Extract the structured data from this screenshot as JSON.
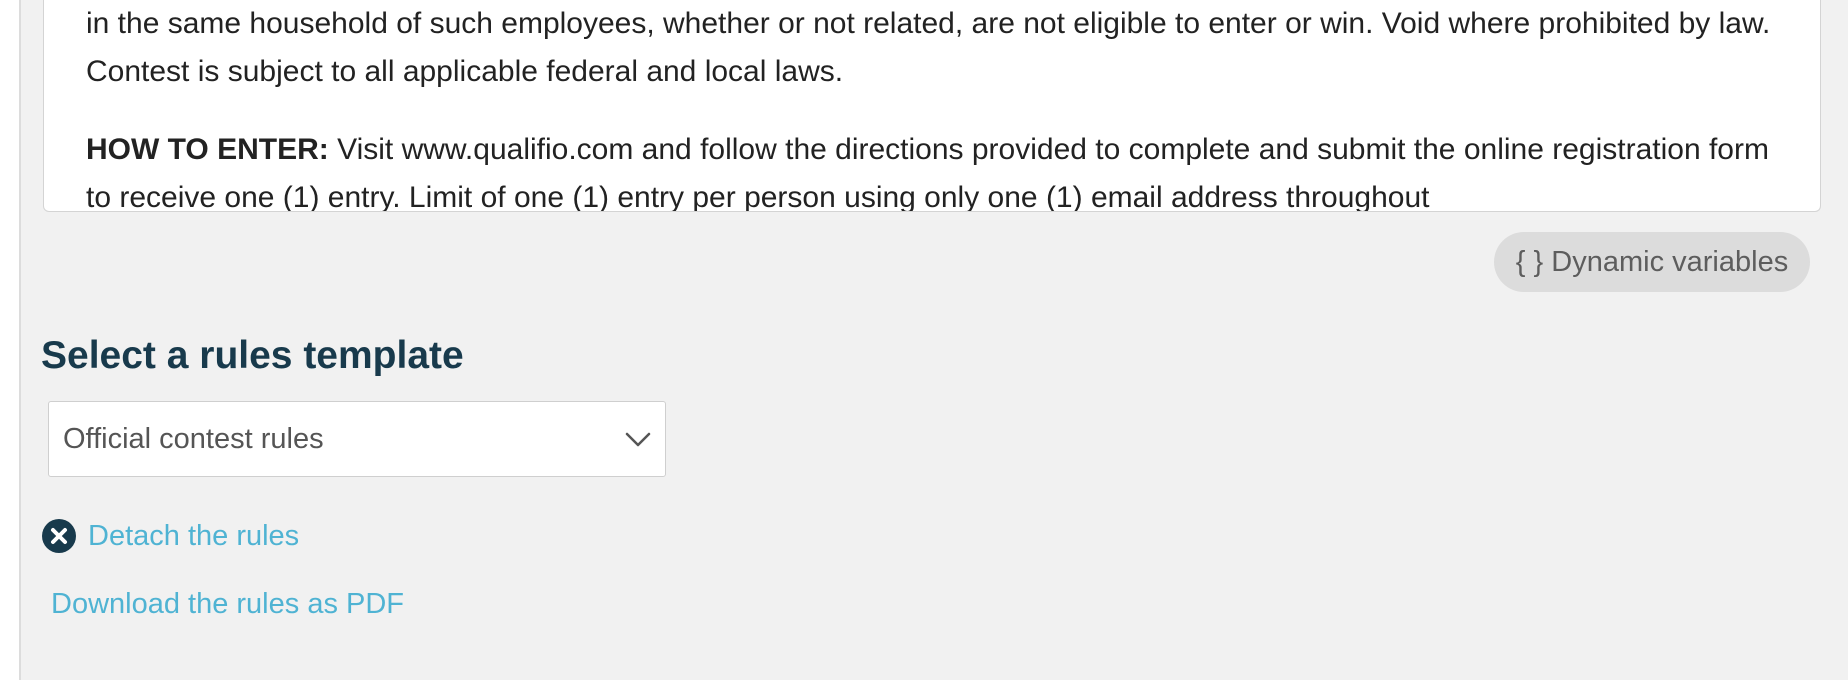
{
  "rules_editor": {
    "paragraph_1": "in the same household of such employees, whether or not related, are not eligible to enter or win. Void where prohibited by law. Contest is subject to all applicable federal and local laws.",
    "paragraph_2_label": "HOW TO ENTER:",
    "paragraph_2_text": "Visit www.qualifio.com and follow the directions provided to complete and submit the online registration form to receive one (1) entry. Limit of one (1) entry per person using only one (1) email address throughout"
  },
  "dynamic_variables_button": {
    "label": "{ } Dynamic variables"
  },
  "rules_template": {
    "title": "Select a rules template",
    "selected_value": "Official contest rules"
  },
  "actions": {
    "detach_label": "Detach the rules",
    "download_label": "Download the rules as PDF"
  },
  "colors": {
    "link": "#4fb3d3",
    "title": "#183a4c",
    "panel_background": "#f1f1f1",
    "detach_icon": "#183a4c"
  },
  "icons": {
    "detach": "close-circle-icon",
    "select": "chevron-down-icon"
  }
}
